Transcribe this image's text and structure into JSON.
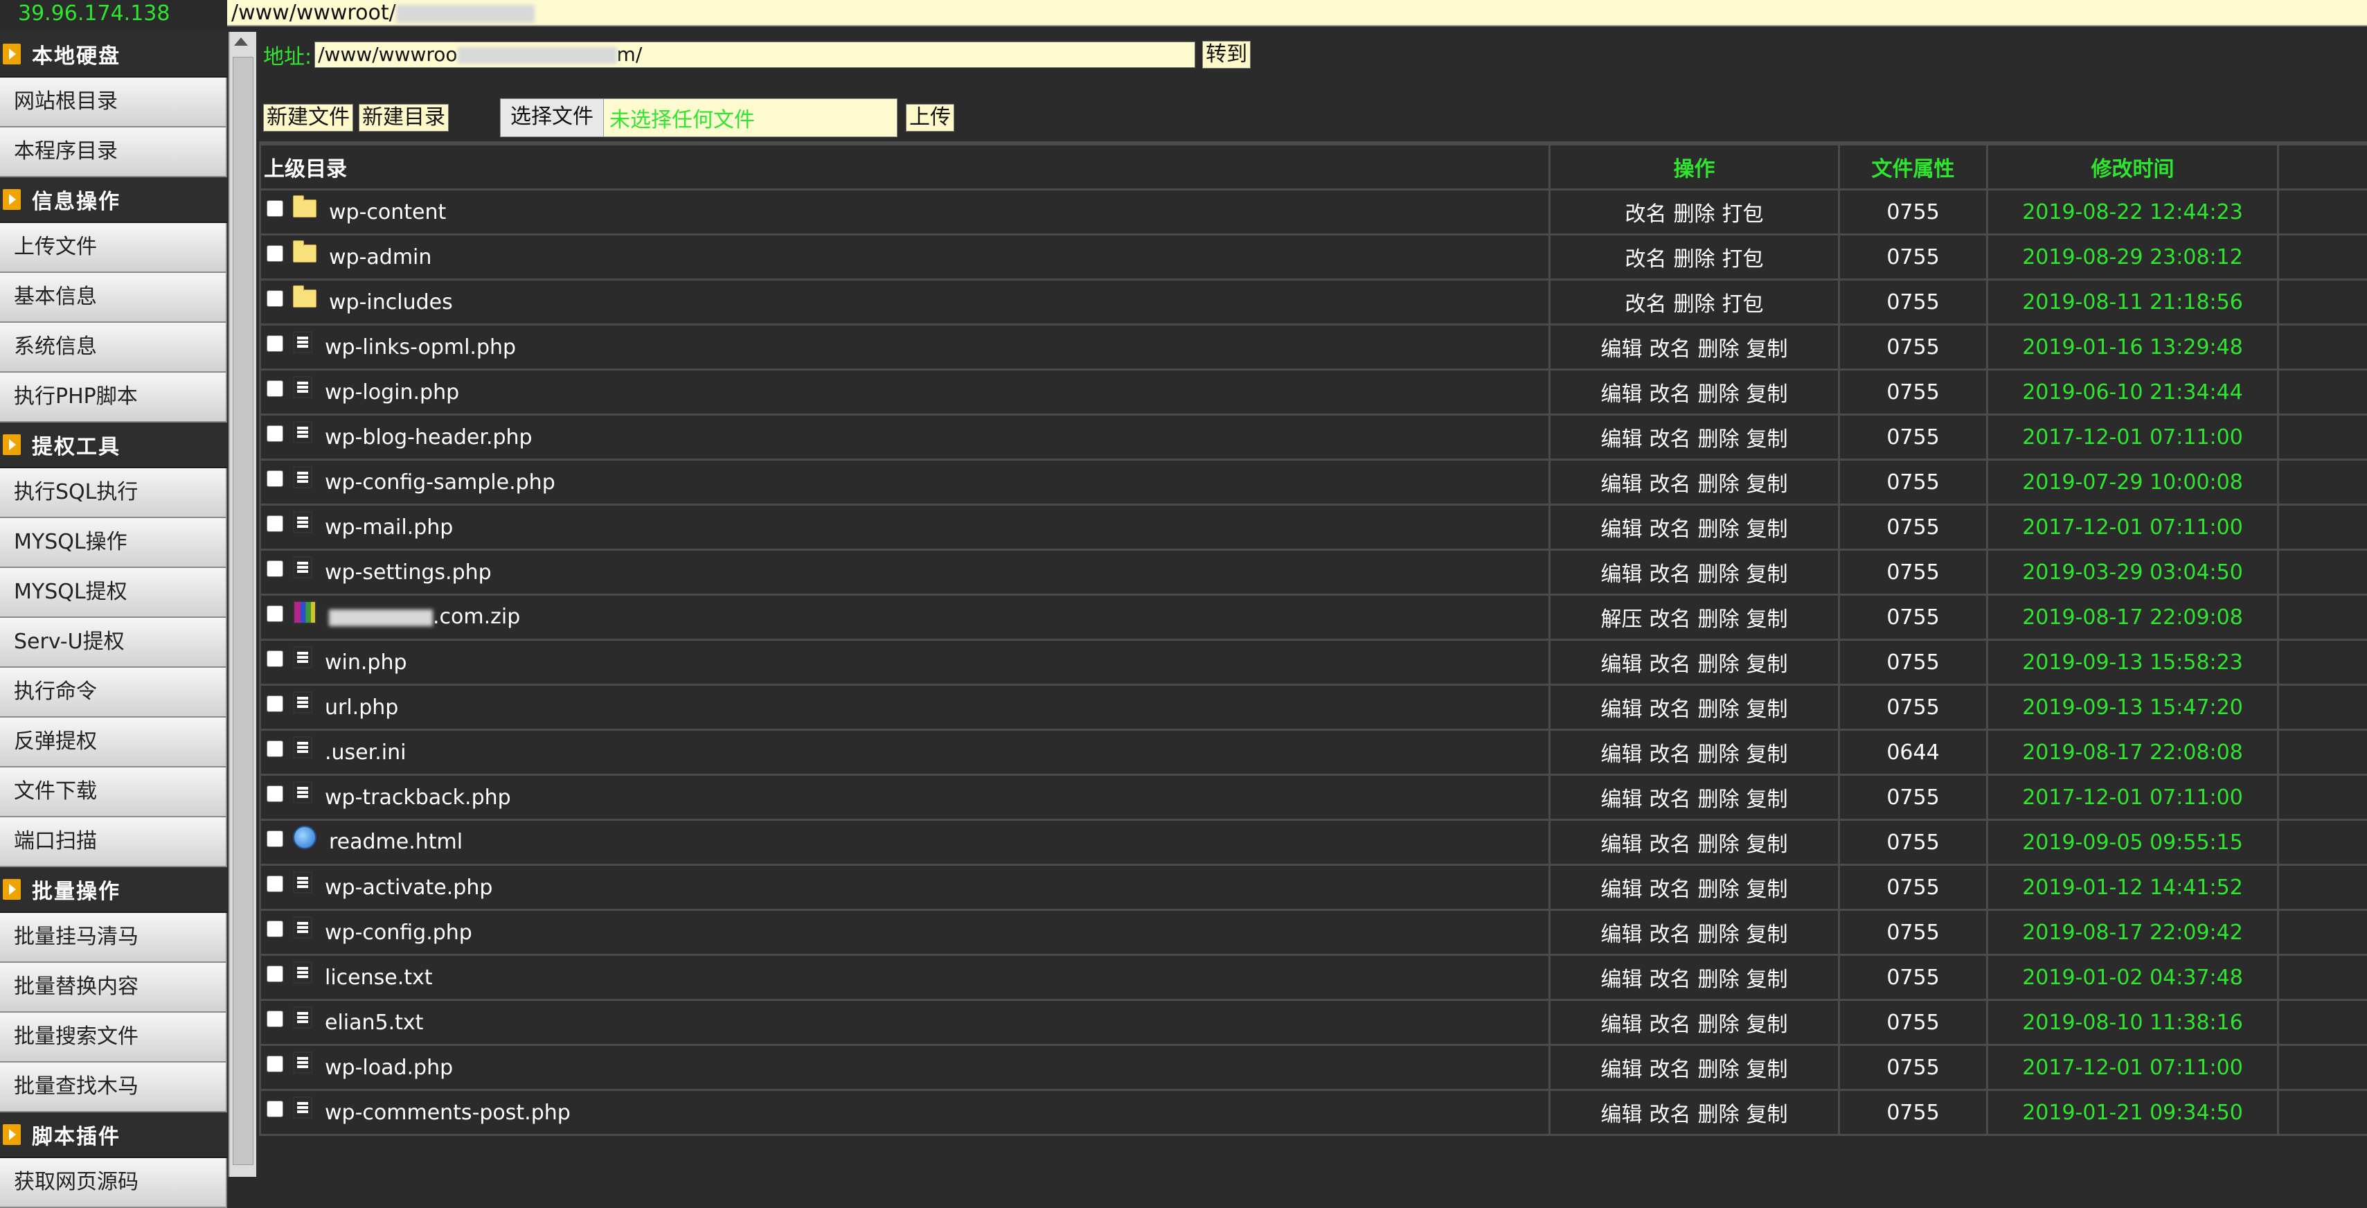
{
  "top": {
    "ip": "39.96.174.138",
    "path_prefix": "/www/wwwroot/"
  },
  "sidebar": {
    "groups": [
      {
        "header": "本地硬盘",
        "items": [
          "网站根目录",
          "本程序目录"
        ]
      },
      {
        "header": "信息操作",
        "items": [
          "上传文件",
          "基本信息",
          "系统信息",
          "执行PHP脚本"
        ]
      },
      {
        "header": "提权工具",
        "items": [
          "执行SQL执行",
          "MYSQL操作",
          "MYSQL提权",
          "Serv-U提权",
          "执行命令",
          "反弹提权",
          "文件下载",
          "端口扫描"
        ]
      },
      {
        "header": "批量操作",
        "items": [
          "批量挂马清马",
          "批量替换内容",
          "批量搜索文件",
          "批量查找木马"
        ]
      },
      {
        "header": "脚本插件",
        "items": [
          "获取网页源码"
        ]
      }
    ]
  },
  "address": {
    "label": "地址:",
    "value_prefix": "/www/wwwroo",
    "value_suffix": "m/",
    "go_label": "转到"
  },
  "toolbar": {
    "new_file": "新建文件",
    "new_dir": "新建目录",
    "choose_file": "选择文件",
    "no_file": "未选择任何文件",
    "upload": "上传"
  },
  "table": {
    "parent_dir": "上级目录",
    "col_ops": "操作",
    "col_attr": "文件属性",
    "col_time": "修改时间",
    "rows": [
      {
        "name": "wp-content",
        "icon": "folder-icon",
        "ops": [
          "改名",
          "删除",
          "打包"
        ],
        "attr": "0755",
        "time": "2019-08-22 12:44:23"
      },
      {
        "name": "wp-admin",
        "icon": "folder-icon",
        "ops": [
          "改名",
          "删除",
          "打包"
        ],
        "attr": "0755",
        "time": "2019-08-29 23:08:12"
      },
      {
        "name": "wp-includes",
        "icon": "folder-icon",
        "ops": [
          "改名",
          "删除",
          "打包"
        ],
        "attr": "0755",
        "time": "2019-08-11 21:18:56"
      },
      {
        "name": "wp-links-opml.php",
        "icon": "document-icon",
        "ops": [
          "编辑",
          "改名",
          "删除",
          "复制"
        ],
        "attr": "0755",
        "time": "2019-01-16 13:29:48"
      },
      {
        "name": "wp-login.php",
        "icon": "document-icon",
        "ops": [
          "编辑",
          "改名",
          "删除",
          "复制"
        ],
        "attr": "0755",
        "time": "2019-06-10 21:34:44"
      },
      {
        "name": "wp-blog-header.php",
        "icon": "document-icon",
        "ops": [
          "编辑",
          "改名",
          "删除",
          "复制"
        ],
        "attr": "0755",
        "time": "2017-12-01 07:11:00"
      },
      {
        "name": "wp-config-sample.php",
        "icon": "document-icon",
        "ops": [
          "编辑",
          "改名",
          "删除",
          "复制"
        ],
        "attr": "0755",
        "time": "2019-07-29 10:00:08"
      },
      {
        "name": "wp-mail.php",
        "icon": "document-icon",
        "ops": [
          "编辑",
          "改名",
          "删除",
          "复制"
        ],
        "attr": "0755",
        "time": "2017-12-01 07:11:00"
      },
      {
        "name": "wp-settings.php",
        "icon": "document-icon",
        "ops": [
          "编辑",
          "改名",
          "删除",
          "复制"
        ],
        "attr": "0755",
        "time": "2019-03-29 03:04:50"
      },
      {
        "name": ".com.zip",
        "icon": "archive-icon",
        "blurred": true,
        "ops": [
          "解压",
          "改名",
          "删除",
          "复制"
        ],
        "attr": "0755",
        "time": "2019-08-17 22:09:08"
      },
      {
        "name": "win.php",
        "icon": "document-icon",
        "ops": [
          "编辑",
          "改名",
          "删除",
          "复制"
        ],
        "attr": "0755",
        "time": "2019-09-13 15:58:23"
      },
      {
        "name": "url.php",
        "icon": "document-icon",
        "ops": [
          "编辑",
          "改名",
          "删除",
          "复制"
        ],
        "attr": "0755",
        "time": "2019-09-13 15:47:20"
      },
      {
        "name": ".user.ini",
        "icon": "document-icon",
        "ops": [
          "编辑",
          "改名",
          "删除",
          "复制"
        ],
        "attr": "0644",
        "time": "2019-08-17 22:08:08"
      },
      {
        "name": "wp-trackback.php",
        "icon": "document-icon",
        "ops": [
          "编辑",
          "改名",
          "删除",
          "复制"
        ],
        "attr": "0755",
        "time": "2017-12-01 07:11:00"
      },
      {
        "name": "readme.html",
        "icon": "html-file-icon",
        "ops": [
          "编辑",
          "改名",
          "删除",
          "复制"
        ],
        "attr": "0755",
        "time": "2019-09-05 09:55:15"
      },
      {
        "name": "wp-activate.php",
        "icon": "document-icon",
        "ops": [
          "编辑",
          "改名",
          "删除",
          "复制"
        ],
        "attr": "0755",
        "time": "2019-01-12 14:41:52"
      },
      {
        "name": "wp-config.php",
        "icon": "document-icon",
        "ops": [
          "编辑",
          "改名",
          "删除",
          "复制"
        ],
        "attr": "0755",
        "time": "2019-08-17 22:09:42"
      },
      {
        "name": "license.txt",
        "icon": "document-icon",
        "ops": [
          "编辑",
          "改名",
          "删除",
          "复制"
        ],
        "attr": "0755",
        "time": "2019-01-02 04:37:48"
      },
      {
        "name": "elian5.txt",
        "icon": "document-icon",
        "ops": [
          "编辑",
          "改名",
          "删除",
          "复制"
        ],
        "attr": "0755",
        "time": "2019-08-10 11:38:16"
      },
      {
        "name": "wp-load.php",
        "icon": "document-icon",
        "ops": [
          "编辑",
          "改名",
          "删除",
          "复制"
        ],
        "attr": "0755",
        "time": "2017-12-01 07:11:00"
      },
      {
        "name": "wp-comments-post.php",
        "icon": "document-icon",
        "ops": [
          "编辑",
          "改名",
          "删除",
          "复制"
        ],
        "attr": "0755",
        "time": "2019-01-21 09:34:50"
      }
    ]
  },
  "colors": {
    "accent_green": "#2ee62e",
    "background": "#2b2b2b",
    "input_bg": "#fffbd0"
  }
}
